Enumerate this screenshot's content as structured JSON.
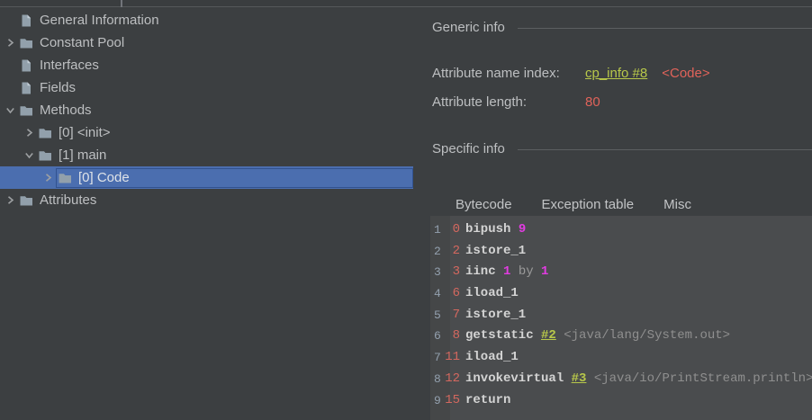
{
  "colors": {
    "background": "#3c3f41",
    "selection_blue": "#4b6eaf",
    "link_green": "#b8c84a",
    "value_red": "#e0635a",
    "offset_red": "#d4685f",
    "immediate_magenta": "#e23ce2",
    "bytecode_panel_bg": "#4a4c4e",
    "gutter_number_blue": "#93a0ae"
  },
  "tree": {
    "items": [
      {
        "label": "General Information",
        "icon": "document",
        "chevron": "none",
        "level": 0,
        "selected": false
      },
      {
        "label": "Constant Pool",
        "icon": "folder",
        "chevron": "collapsed",
        "level": 0,
        "selected": false
      },
      {
        "label": "Interfaces",
        "icon": "document",
        "chevron": "none",
        "level": 0,
        "selected": false
      },
      {
        "label": "Fields",
        "icon": "document",
        "chevron": "none",
        "level": 0,
        "selected": false
      },
      {
        "label": "Methods",
        "icon": "folder",
        "chevron": "expanded",
        "level": 0,
        "selected": false
      },
      {
        "label": "[0] <init>",
        "icon": "folder",
        "chevron": "collapsed",
        "level": 1,
        "selected": false
      },
      {
        "label": "[1] main",
        "icon": "folder",
        "chevron": "expanded",
        "level": 1,
        "selected": false
      },
      {
        "label": "[0] Code",
        "icon": "folder",
        "chevron": "collapsed",
        "level": 2,
        "selected": true
      },
      {
        "label": "Attributes",
        "icon": "folder",
        "chevron": "collapsed",
        "level": 0,
        "selected": false
      }
    ]
  },
  "generic_info": {
    "title": "Generic info",
    "rows": [
      {
        "label": "Attribute name index:",
        "parts": [
          {
            "t": "link",
            "v": "cp_info #8"
          },
          {
            "t": "red",
            "v": "<Code>"
          }
        ]
      },
      {
        "label": "Attribute length:",
        "parts": [
          {
            "t": "red",
            "v": "80"
          }
        ]
      }
    ]
  },
  "specific_info": {
    "title": "Specific info",
    "tabs": [
      {
        "label": "Bytecode",
        "active": true
      },
      {
        "label": "Exception table",
        "active": false
      },
      {
        "label": "Misc",
        "active": false
      }
    ]
  },
  "bytecode": {
    "lines": [
      {
        "line": "1",
        "offset": "0",
        "tokens": [
          {
            "t": "op",
            "v": "bipush"
          },
          {
            "t": "imm",
            "v": "9"
          }
        ]
      },
      {
        "line": "2",
        "offset": "2",
        "tokens": [
          {
            "t": "op",
            "v": "istore_1"
          }
        ]
      },
      {
        "line": "3",
        "offset": "3",
        "tokens": [
          {
            "t": "op",
            "v": "iinc"
          },
          {
            "t": "imm",
            "v": "1"
          },
          {
            "t": "kw",
            "v": "by"
          },
          {
            "t": "imm",
            "v": "1"
          }
        ]
      },
      {
        "line": "4",
        "offset": "6",
        "tokens": [
          {
            "t": "op",
            "v": "iload_1"
          }
        ]
      },
      {
        "line": "5",
        "offset": "7",
        "tokens": [
          {
            "t": "op",
            "v": "istore_1"
          }
        ]
      },
      {
        "line": "6",
        "offset": "8",
        "tokens": [
          {
            "t": "op",
            "v": "getstatic"
          },
          {
            "t": "link",
            "v": "#2"
          },
          {
            "t": "comment",
            "v": "<java/lang/System.out>"
          }
        ]
      },
      {
        "line": "7",
        "offset": "11",
        "tokens": [
          {
            "t": "op",
            "v": "iload_1"
          }
        ]
      },
      {
        "line": "8",
        "offset": "12",
        "tokens": [
          {
            "t": "op",
            "v": "invokevirtual"
          },
          {
            "t": "link",
            "v": "#3"
          },
          {
            "t": "comment",
            "v": "<java/io/PrintStream.println>"
          }
        ]
      },
      {
        "line": "9",
        "offset": "15",
        "tokens": [
          {
            "t": "op",
            "v": "return"
          }
        ]
      }
    ]
  }
}
